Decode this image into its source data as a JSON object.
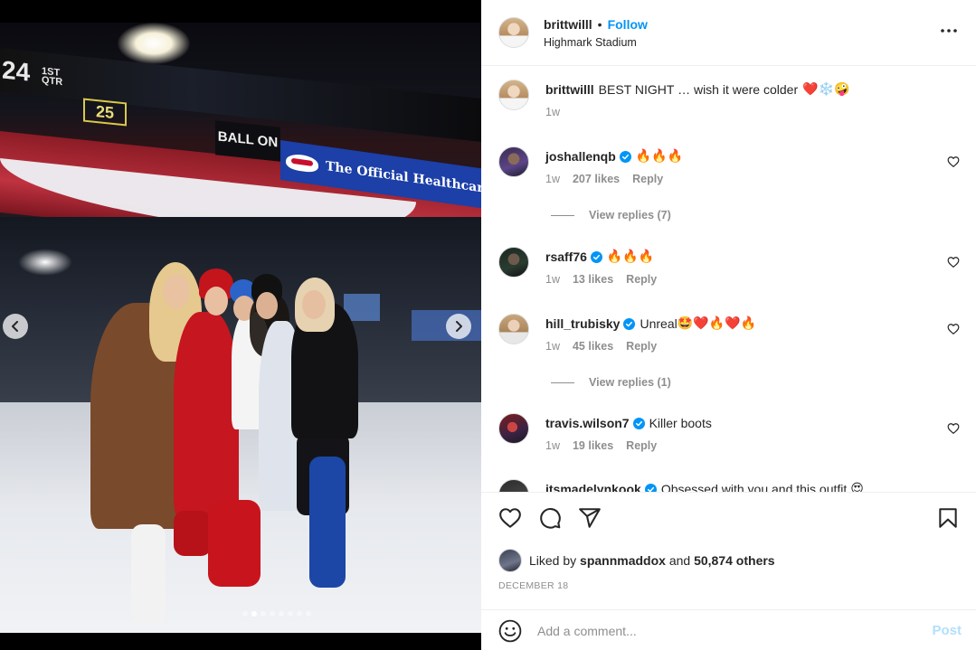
{
  "media": {
    "scoreboard": {
      "score": "24",
      "quarter_line1": "1ST",
      "quarter_line2": "QTR",
      "yard_line": "25",
      "ball_on": "BALL ON"
    },
    "banner_text": "The Official Healthcare Provider of",
    "carousel": {
      "total_slides": 8,
      "active_index": 1
    }
  },
  "header": {
    "username": "brittwilll",
    "separator": "•",
    "follow_label": "Follow",
    "location": "Highmark Stadium"
  },
  "caption": {
    "username": "brittwilll",
    "text": "BEST NIGHT … wish it were colder",
    "emoji": "❤️❄️🤪",
    "time": "1w"
  },
  "comments": [
    {
      "username": "joshallenqb",
      "verified": true,
      "text": "",
      "emoji": "🔥🔥🔥",
      "time": "1w",
      "likes": "207 likes",
      "reply": "Reply",
      "view_replies": "View replies (7)"
    },
    {
      "username": "rsaff76",
      "verified": true,
      "text": "",
      "emoji": "🔥🔥🔥",
      "time": "1w",
      "likes": "13 likes",
      "reply": "Reply"
    },
    {
      "username": "hill_trubisky",
      "verified": true,
      "text": "Unreal",
      "emoji": "🤩❤️🔥❤️🔥",
      "time": "1w",
      "likes": "45 likes",
      "reply": "Reply",
      "view_replies": "View replies (1)"
    },
    {
      "username": "travis.wilson7",
      "verified": true,
      "text": "Killer boots",
      "emoji": "",
      "time": "1w",
      "likes": "19 likes",
      "reply": "Reply"
    },
    {
      "username": "itsmadelynkook",
      "verified": true,
      "text": "Obsessed with you and this outfit",
      "emoji": "😍"
    }
  ],
  "footer": {
    "liked_by_prefix": "Liked by",
    "liked_by_user": "spannmaddox",
    "liked_by_and": "and",
    "liked_by_others": "50,874 others",
    "date": "DECEMBER 18",
    "comment_placeholder": "Add a comment...",
    "post_label": "Post"
  },
  "colors": {
    "accent": "#0095f6",
    "post_disabled": "#b2dffc",
    "muted": "#8e8e8e",
    "text": "#262626"
  },
  "icons": [
    "more-icon",
    "heart-icon",
    "comment-icon",
    "share-icon",
    "bookmark-icon",
    "emoji-icon",
    "verified-icon",
    "chevron-left-icon",
    "chevron-right-icon"
  ]
}
